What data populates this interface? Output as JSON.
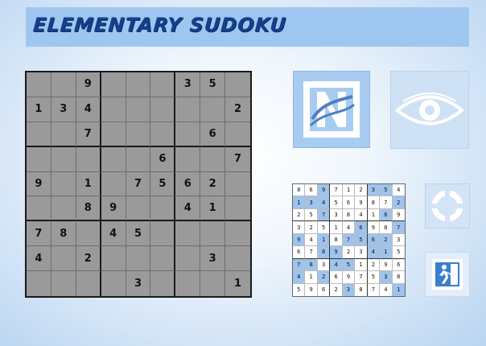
{
  "app": {
    "title": "ELEMENTARY SUDOKU"
  },
  "board": {
    "grid": [
      [
        "",
        "",
        "9",
        "",
        "",
        "",
        "3",
        "5",
        ""
      ],
      [
        "1",
        "3",
        "4",
        "",
        "",
        "",
        "",
        "",
        "2"
      ],
      [
        "",
        "",
        "7",
        "",
        "",
        "",
        "",
        "6",
        ""
      ],
      [
        "",
        "",
        "",
        "",
        "",
        "6",
        "",
        "",
        "7"
      ],
      [
        "9",
        "",
        "1",
        "",
        "7",
        "5",
        "6",
        "2",
        ""
      ],
      [
        "",
        "",
        "8",
        "9",
        "",
        "",
        "4",
        "1",
        ""
      ],
      [
        "7",
        "8",
        "",
        "4",
        "5",
        "",
        "",
        "",
        ""
      ],
      [
        "4",
        "",
        "2",
        "",
        "",
        "",
        "",
        "3",
        ""
      ],
      [
        "",
        "",
        "",
        "",
        "3",
        "",
        "",
        "",
        "1"
      ]
    ]
  },
  "solution_preview": {
    "grid": [
      [
        "8",
        "6",
        "9",
        "7",
        "1",
        "2",
        "3",
        "5",
        "4"
      ],
      [
        "1",
        "3",
        "4",
        "5",
        "6",
        "9",
        "8",
        "7",
        "2"
      ],
      [
        "2",
        "5",
        "7",
        "3",
        "8",
        "4",
        "1",
        "6",
        "9"
      ],
      [
        "3",
        "2",
        "5",
        "1",
        "4",
        "6",
        "9",
        "8",
        "7"
      ],
      [
        "9",
        "4",
        "1",
        "8",
        "7",
        "5",
        "6",
        "2",
        "3"
      ],
      [
        "6",
        "7",
        "8",
        "9",
        "2",
        "3",
        "4",
        "1",
        "5"
      ],
      [
        "7",
        "8",
        "3",
        "4",
        "5",
        "1",
        "2",
        "9",
        "6"
      ],
      [
        "4",
        "1",
        "2",
        "6",
        "9",
        "7",
        "5",
        "3",
        "8"
      ],
      [
        "5",
        "9",
        "6",
        "2",
        "3",
        "8",
        "7",
        "4",
        "1"
      ]
    ]
  },
  "controls": {
    "new_game_icon": "new-game-icon",
    "show_solution_icon": "eye-icon",
    "restart_icon": "refresh-ring-icon",
    "exit_icon": "exit-running-man-icon"
  },
  "colors": {
    "title_bg": "#9fc6ef",
    "title_text": "#143f8a",
    "board_cell": "#9a9a9a",
    "given_highlight": "#9fc3eb"
  }
}
